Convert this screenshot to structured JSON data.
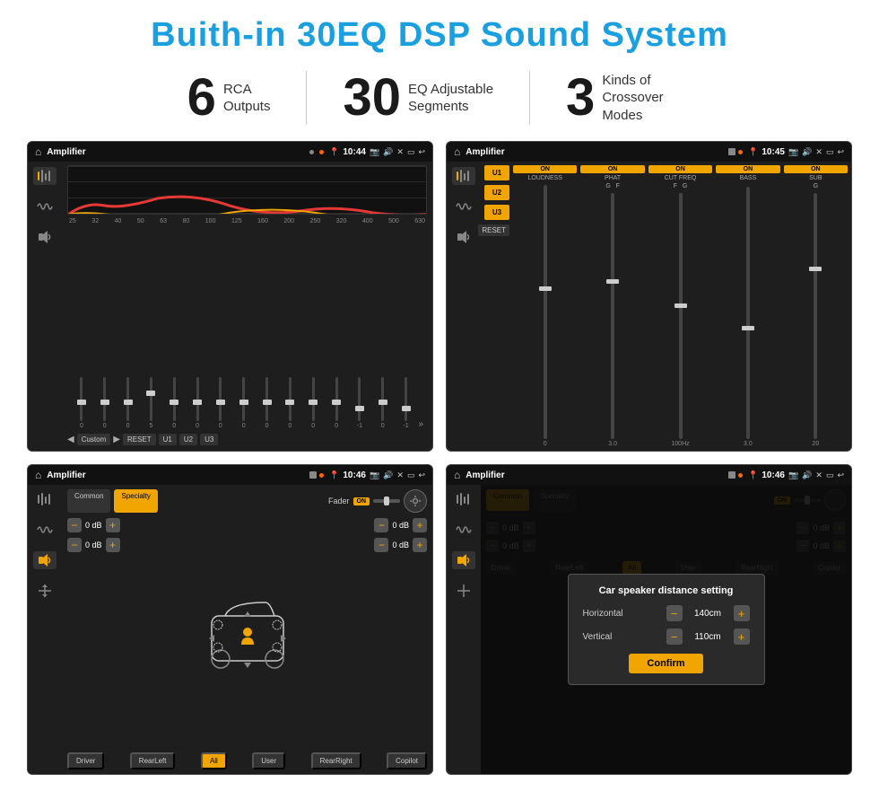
{
  "title": "Buith-in 30EQ DSP Sound System",
  "stats": [
    {
      "number": "6",
      "label": "RCA\nOutputs"
    },
    {
      "number": "30",
      "label": "EQ Adjustable\nSegments"
    },
    {
      "number": "3",
      "label": "Kinds of\nCrossover Modes"
    }
  ],
  "screens": {
    "eq": {
      "title": "Amplifier",
      "time": "10:44",
      "freq_labels": [
        "25",
        "32",
        "40",
        "50",
        "63",
        "80",
        "100",
        "125",
        "160",
        "200",
        "250",
        "320",
        "400",
        "500",
        "630"
      ],
      "slider_values": [
        "0",
        "0",
        "0",
        "5",
        "0",
        "0",
        "0",
        "0",
        "0",
        "0",
        "0",
        "0",
        "-1",
        "0",
        "-1"
      ],
      "buttons": [
        "Custom",
        "RESET",
        "U1",
        "U2",
        "U3"
      ],
      "expand_icon": "»"
    },
    "crossover": {
      "title": "Amplifier",
      "time": "10:45",
      "presets": [
        "U1",
        "U2",
        "U3"
      ],
      "channels": [
        {
          "label": "LOUDNESS",
          "on": true
        },
        {
          "label": "PHAT",
          "on": true
        },
        {
          "label": "CUT FREQ",
          "on": true
        },
        {
          "label": "BASS",
          "on": true
        },
        {
          "label": "SUB",
          "on": true
        }
      ],
      "reset_btn": "RESET"
    },
    "fader": {
      "title": "Amplifier",
      "time": "10:46",
      "tabs": [
        "Common",
        "Specialty"
      ],
      "active_tab": "Specialty",
      "fader_label": "Fader",
      "fader_on": "ON",
      "db_values": [
        "0 dB",
        "0 dB",
        "0 dB",
        "0 dB"
      ],
      "bottom_btns": [
        "Driver",
        "RearLeft",
        "All",
        "User",
        "RearRight",
        "Copilot"
      ]
    },
    "distance": {
      "title": "Amplifier",
      "time": "10:46",
      "tabs": [
        "Common",
        "Specialty"
      ],
      "active_tab": "Common",
      "modal": {
        "title": "Car speaker distance setting",
        "horizontal_label": "Horizontal",
        "horizontal_value": "140cm",
        "vertical_label": "Vertical",
        "vertical_value": "110cm",
        "confirm_btn": "Confirm"
      },
      "db_values": [
        "0 dB",
        "0 dB"
      ],
      "bottom_btns": [
        "Driver",
        "RearLeft",
        "All",
        "User",
        "RearRight",
        "Copilot"
      ]
    }
  }
}
